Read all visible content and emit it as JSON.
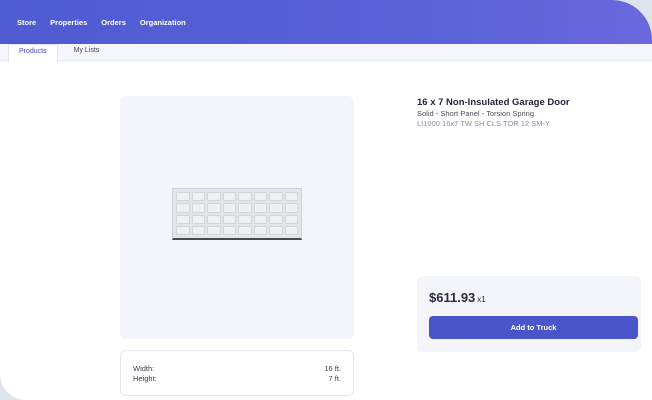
{
  "nav": {
    "items": [
      {
        "label": "Store"
      },
      {
        "label": "Properties"
      },
      {
        "label": "Orders"
      },
      {
        "label": "Organization"
      }
    ]
  },
  "tabs": [
    {
      "label": "Products",
      "active": true
    },
    {
      "label": "My Lists",
      "active": false
    }
  ],
  "product": {
    "title": "16 x 7 Non-Insulated Garage Door",
    "subtitle": "Solid - Short Panel - Torsion Spring",
    "sku": "LI1000 16x7 TW SH CLS TOR 12 SM-Y",
    "image_icon": "garage-door-image",
    "specs": [
      {
        "label": "Width:",
        "value": "16 ft."
      },
      {
        "label": "Height:",
        "value": "7 ft."
      }
    ]
  },
  "purchase": {
    "price": "$611.93",
    "quantity": "x1",
    "add_label": "Add to Truck"
  },
  "colors": {
    "accent": "#4a55c9",
    "nav_gradient_start": "#4f5bd1",
    "nav_gradient_end": "#6a68dd",
    "panel_bg": "#f4f5fb"
  }
}
